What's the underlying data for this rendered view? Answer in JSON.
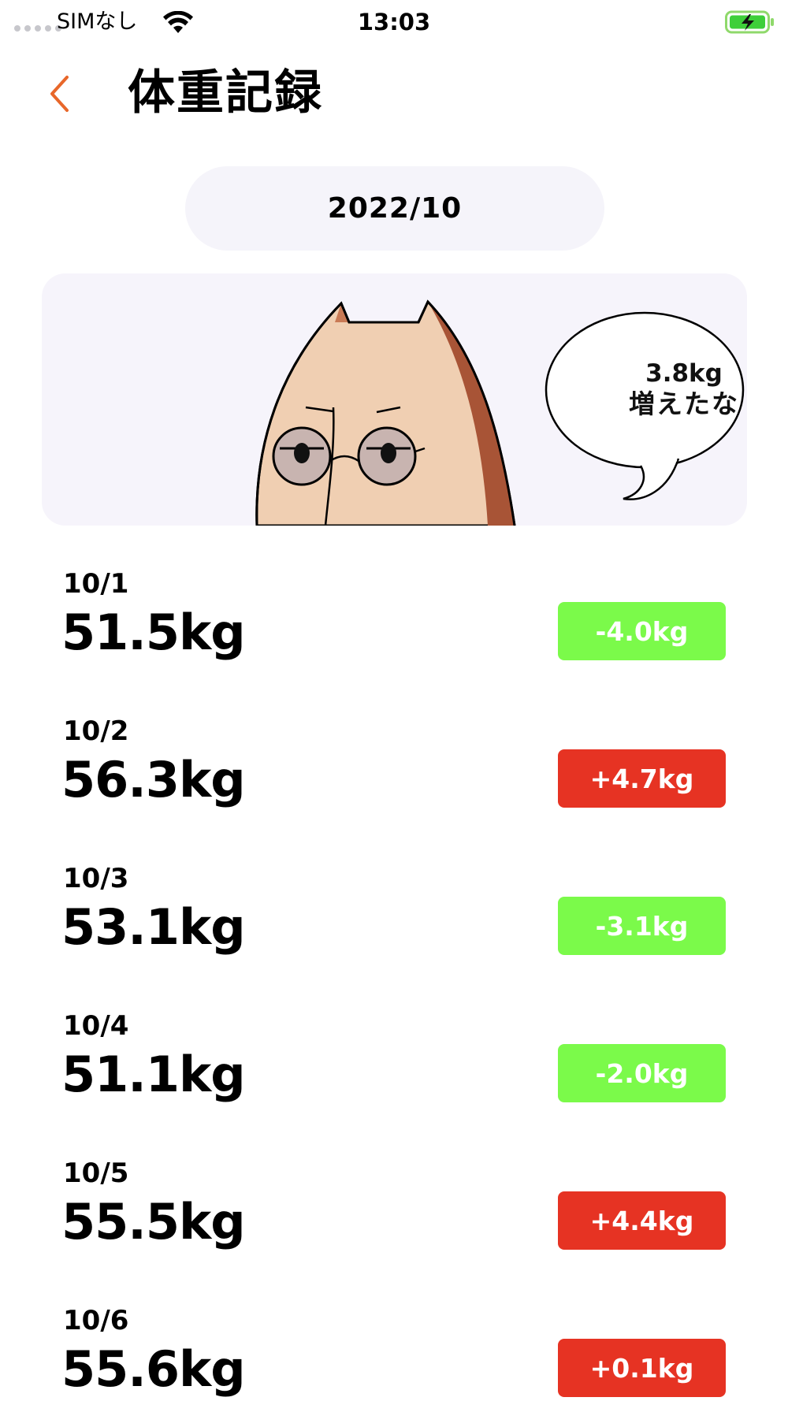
{
  "status_bar": {
    "carrier": "SIMなし",
    "time": "13:03"
  },
  "header": {
    "title": "体重記録",
    "back_icon": "chevron-left-icon"
  },
  "month_selector": {
    "label": "2022/10"
  },
  "banner": {
    "bubble_amount": "3.8kg",
    "bubble_phrase": "増えたな"
  },
  "colors": {
    "accent": "#e8672a",
    "decrease": "#7bfa4a",
    "increase": "#e63323",
    "pill_bg": "#f5f4fa"
  },
  "records": [
    {
      "date": "10/1",
      "weight": "51.5kg",
      "diff": "-4.0kg",
      "trend": "down"
    },
    {
      "date": "10/2",
      "weight": "56.3kg",
      "diff": "+4.7kg",
      "trend": "up"
    },
    {
      "date": "10/3",
      "weight": "53.1kg",
      "diff": "-3.1kg",
      "trend": "down"
    },
    {
      "date": "10/4",
      "weight": "51.1kg",
      "diff": "-2.0kg",
      "trend": "down"
    },
    {
      "date": "10/5",
      "weight": "55.5kg",
      "diff": "+4.4kg",
      "trend": "up"
    },
    {
      "date": "10/6",
      "weight": "55.6kg",
      "diff": "+0.1kg",
      "trend": "up"
    }
  ]
}
